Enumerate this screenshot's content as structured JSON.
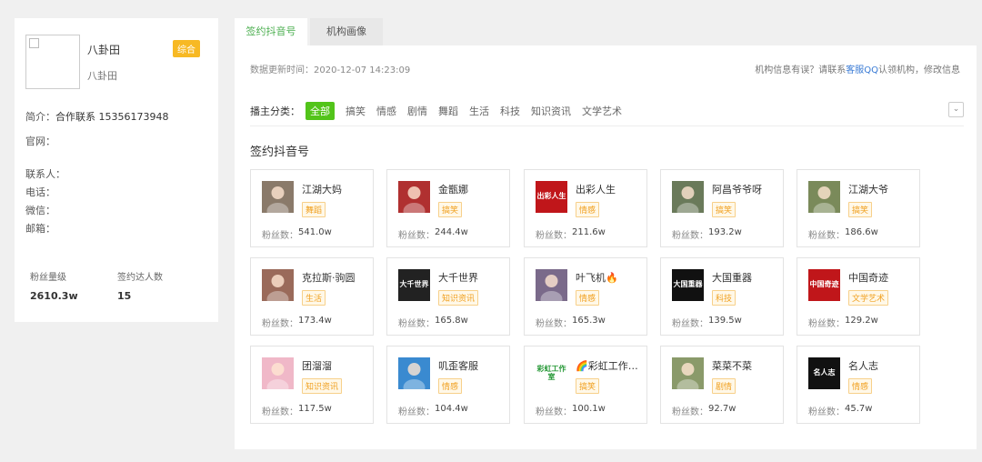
{
  "profile": {
    "name": "八卦田",
    "subname": "八卦田",
    "badge": "综合",
    "intro_label": "简介：",
    "intro_value": "合作联系 15356173948",
    "website_label": "官网：",
    "contact_label": "联系人：",
    "phone_label": "电话：",
    "wechat_label": "微信：",
    "email_label": "邮箱：",
    "stats": [
      {
        "label": "粉丝量级",
        "value": "2610.3w"
      },
      {
        "label": "签约达人数",
        "value": "15"
      }
    ]
  },
  "tabs": [
    {
      "label": "签约抖音号",
      "active": true
    },
    {
      "label": "机构画像",
      "active": false
    }
  ],
  "main": {
    "update_time": "数据更新时间：2020-12-07 14:23:09",
    "notice_prefix": "机构信息有误？请联系",
    "notice_link": "客服QQ",
    "notice_suffix": "认领机构，修改信息",
    "filter_label": "播主分类：",
    "filters": [
      "全部",
      "搞笑",
      "情感",
      "剧情",
      "舞蹈",
      "生活",
      "科技",
      "知识资讯",
      "文学艺术"
    ],
    "active_filter": "全部",
    "section_title": "签约抖音号",
    "fans_label": "粉丝数：",
    "expand_icon": "chevron-down-icon"
  },
  "accounts": [
    {
      "name": "江湖大妈",
      "tag": "舞蹈",
      "fans": "541.0w",
      "thumb": "photo",
      "thumb_color": "#8a7a6a"
    },
    {
      "name": "金甑娜",
      "tag": "搞笑",
      "fans": "244.4w",
      "thumb": "photo",
      "thumb_color": "#b03030"
    },
    {
      "name": "出彩人生",
      "tag": "情感",
      "fans": "211.6w",
      "thumb": "出彩人生",
      "thumb_color": "#c0161a"
    },
    {
      "name": "阿昌爷爷呀",
      "tag": "搞笑",
      "fans": "193.2w",
      "thumb": "photo",
      "thumb_color": "#6a7a5a"
    },
    {
      "name": "江湖大爷",
      "tag": "搞笑",
      "fans": "186.6w",
      "thumb": "photo",
      "thumb_color": "#7a8a5a"
    },
    {
      "name": "克拉斯·驹圆",
      "tag": "生活",
      "fans": "173.4w",
      "thumb": "photo",
      "thumb_color": "#9a6a5a"
    },
    {
      "name": "大千世界",
      "tag": "知识资讯",
      "fans": "165.8w",
      "thumb": "大千世界",
      "thumb_color": "#222222"
    },
    {
      "name": "叶飞机🔥",
      "tag": "情感",
      "fans": "165.3w",
      "thumb": "photo",
      "thumb_color": "#7a6a8a"
    },
    {
      "name": "大国重器",
      "tag": "科技",
      "fans": "139.5w",
      "thumb": "大国重器",
      "thumb_color": "#111111"
    },
    {
      "name": "中国奇迹",
      "tag": "文学艺术",
      "fans": "129.2w",
      "thumb": "中国奇迹",
      "thumb_color": "#c0161a"
    },
    {
      "name": "团溜溜",
      "tag": "知识资讯",
      "fans": "117.5w",
      "thumb": "photo",
      "thumb_color": "#f0b8c8"
    },
    {
      "name": "叽歪客服",
      "tag": "情感",
      "fans": "104.4w",
      "thumb": "photo",
      "thumb_color": "#3a8ad0"
    },
    {
      "name": "🌈彩虹工作室...",
      "tag": "搞笑",
      "fans": "100.1w",
      "thumb": "彩虹工作室",
      "thumb_color": "#ffffff"
    },
    {
      "name": "菜菜不菜",
      "tag": "剧情",
      "fans": "92.7w",
      "thumb": "photo",
      "thumb_color": "#8a9a6a"
    },
    {
      "name": "名人志",
      "tag": "情感",
      "fans": "45.7w",
      "thumb": "名人志",
      "thumb_color": "#111111"
    }
  ]
}
